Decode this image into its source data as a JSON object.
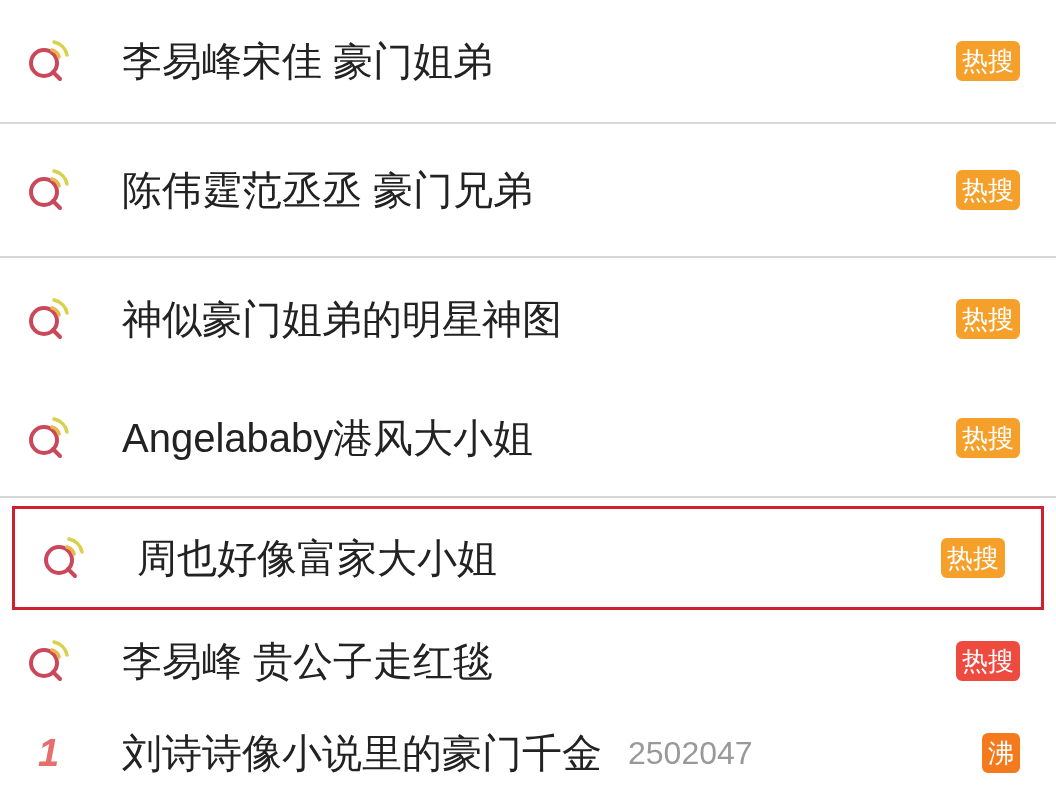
{
  "items": [
    {
      "kind": "search",
      "title": "李易峰宋佳 豪门姐弟",
      "badge": "热搜",
      "color": "#f5a02a",
      "highlighted": false,
      "divider_below": true
    },
    {
      "kind": "search",
      "title": "陈伟霆范丞丞 豪门兄弟",
      "badge": "热搜",
      "color": "#f5a02a",
      "highlighted": false,
      "divider_below": true
    },
    {
      "kind": "search",
      "title": "神似豪门姐弟的明星神图",
      "badge": "热搜",
      "color": "#f5a02a",
      "highlighted": false,
      "divider_below": false
    },
    {
      "kind": "search",
      "title": "Angelababy港风大小姐",
      "badge": "热搜",
      "color": "#f5a02a",
      "highlighted": false,
      "divider_below": true
    },
    {
      "kind": "search",
      "title": "周也好像富家大小姐",
      "badge": "热搜",
      "color": "#f5a02a",
      "highlighted": true,
      "divider_below": false
    },
    {
      "kind": "search",
      "title": "李易峰 贵公子走红毯",
      "badge": "热搜",
      "color": "#ef4a3f",
      "highlighted": false,
      "divider_below": false
    },
    {
      "kind": "rank",
      "rank": "1",
      "title": "刘诗诗像小说里的豪门千金",
      "count": "2502047",
      "badge": "沸",
      "color": "#f57a1e",
      "highlighted": false,
      "divider_below": false
    }
  ]
}
